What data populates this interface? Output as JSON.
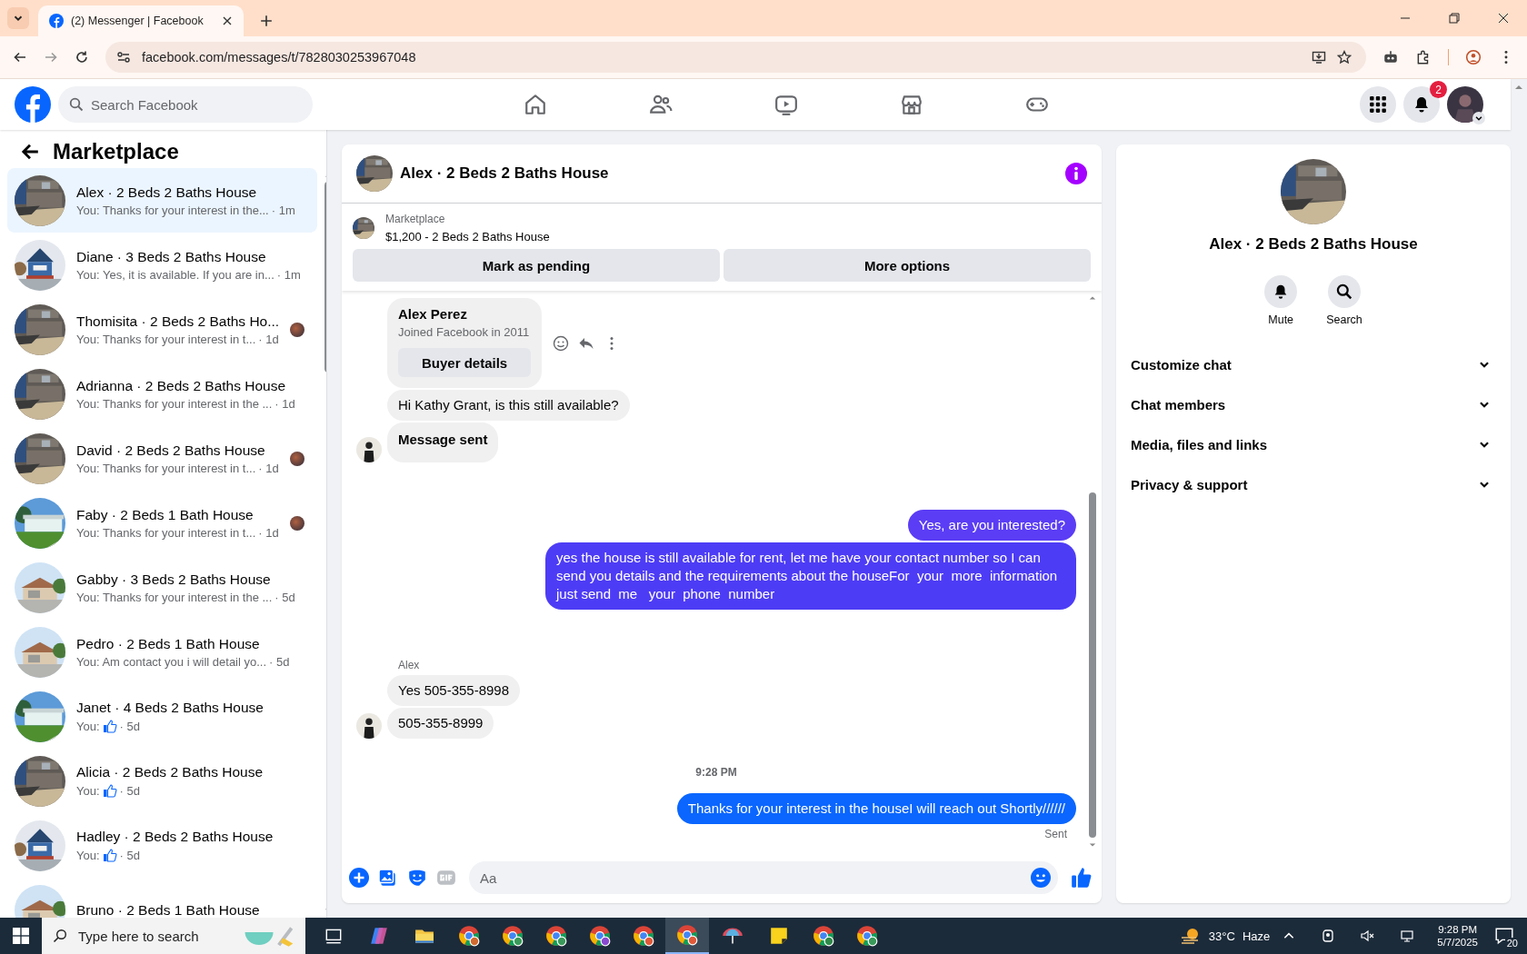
{
  "browser": {
    "tab_title": "(2) Messenger | Facebook",
    "url": "facebook.com/messages/t/7828030253967048"
  },
  "topnav": {
    "search_placeholder": "Search Facebook",
    "notification_badge": "2",
    "tabs": [
      {
        "kind": "home",
        "selected": false
      },
      {
        "kind": "friends",
        "selected": false
      },
      {
        "kind": "video",
        "selected": false
      },
      {
        "kind": "marketplace",
        "selected": false
      },
      {
        "kind": "gaming",
        "selected": false
      }
    ]
  },
  "sidebar": {
    "title": "Marketplace",
    "items": [
      {
        "name": "Alex · 2 Beds 2 Baths House",
        "preview": "You: Thanks for your interest in the...",
        "time": "· 1m",
        "kind": "text",
        "selected": true,
        "seen": false
      },
      {
        "name": "Diane · 3 Beds 2 Baths House",
        "preview": "You: Yes, it is available. If you are in...",
        "time": "· 1m",
        "kind": "text",
        "selected": false,
        "seen": false
      },
      {
        "name": "Thomisita · 2 Beds 2 Baths Ho...",
        "preview": "You: Thanks for your interest in t...",
        "time": "· 1d",
        "kind": "text",
        "selected": false,
        "seen": true
      },
      {
        "name": "Adrianna · 2 Beds 2 Baths House",
        "preview": "You: Thanks for your interest in the ...",
        "time": "· 1d",
        "kind": "text",
        "selected": false,
        "seen": false
      },
      {
        "name": "David · 2 Beds 2 Baths House",
        "preview": "You: Thanks for your interest in t...",
        "time": "· 1d",
        "kind": "text",
        "selected": false,
        "seen": true
      },
      {
        "name": "Faby · 2 Beds 1 Bath House",
        "preview": "You: Thanks for your interest in t...",
        "time": "· 1d",
        "kind": "text",
        "selected": false,
        "seen": true
      },
      {
        "name": "Gabby · 3 Beds 2 Baths House",
        "preview": "You: Thanks for your interest in the ...",
        "time": "· 5d",
        "kind": "text",
        "selected": false,
        "seen": false
      },
      {
        "name": "Pedro · 2 Beds 1 Bath House",
        "preview": "You: Am contact you i will detail yo...",
        "time": "· 5d",
        "kind": "text",
        "selected": false,
        "seen": false
      },
      {
        "name": "Janet · 4 Beds 2 Baths House",
        "preview": "You:",
        "time": "· 5d",
        "kind": "like",
        "selected": false,
        "seen": false
      },
      {
        "name": "Alicia · 2 Beds 2 Baths House",
        "preview": "You:",
        "time": "· 5d",
        "kind": "like",
        "selected": false,
        "seen": false
      },
      {
        "name": "Hadley · 2 Beds 2 Baths House",
        "preview": "You:",
        "time": "· 5d",
        "kind": "like",
        "selected": false,
        "seen": false
      },
      {
        "name": "Bruno · 2 Beds 1 Bath House",
        "kind": "cut",
        "selected": false
      }
    ]
  },
  "chat": {
    "title": "Alex · 2 Beds 2 Baths House",
    "listing": {
      "label": "Marketplace",
      "title": "$1,200 - 2 Beds 2 Baths House"
    },
    "actions": [
      "Mark as pending",
      "More options"
    ],
    "messages": [
      {
        "kind": "profile_card",
        "outgoing": false,
        "name": "Alex Perez",
        "detail": "Joined Facebook in 2011",
        "button": "Buyer details",
        "hovered": true,
        "avatar": false
      },
      {
        "kind": "text",
        "outgoing": false,
        "text": "Hi Kathy Grant, is this still available?",
        "avatar": false
      },
      {
        "kind": "notice",
        "outgoing": false,
        "text": "Message sent",
        "avatar": true
      },
      {
        "kind": "text",
        "outgoing": true,
        "text": "Yes, are you interested?",
        "color": "#5b3df5"
      },
      {
        "kind": "text",
        "outgoing": true,
        "text": "yes the house is still available for rent, let me have your contact number so I can send you details and the requirements about the houseFor  your  more  information  just send  me   your  phone  number",
        "color": "#4d3cf5"
      },
      {
        "kind": "sender",
        "text": "Alex"
      },
      {
        "kind": "text",
        "outgoing": false,
        "text": "Yes 505-355-8998",
        "avatar": false
      },
      {
        "kind": "text",
        "outgoing": false,
        "text": "505-355-8999",
        "avatar": true
      },
      {
        "kind": "time",
        "text": "9:28 PM"
      },
      {
        "kind": "text",
        "outgoing": true,
        "text": "Thanks for your interest in the houseI will reach out Shortly//////",
        "color": "#0a66fe"
      },
      {
        "kind": "status",
        "text": "Sent"
      }
    ],
    "composer": {
      "placeholder": "Aa"
    }
  },
  "details": {
    "name": "Alex · 2 Beds 2 Baths House",
    "actions": [
      {
        "kind": "mute",
        "label": "Mute"
      },
      {
        "kind": "search",
        "label": "Search"
      }
    ],
    "sections": [
      {
        "label": "Customize chat",
        "expanded": false
      },
      {
        "label": "Chat members",
        "expanded": false
      },
      {
        "label": "Media, files and links",
        "expanded": false
      },
      {
        "label": "Privacy & support",
        "expanded": false
      }
    ]
  },
  "taskbar": {
    "search_placeholder": "Type here to search",
    "temperature": "33°C",
    "weather": "Haze",
    "time": "9:28 PM",
    "date": "5/7/2025",
    "notification_count": "20"
  }
}
